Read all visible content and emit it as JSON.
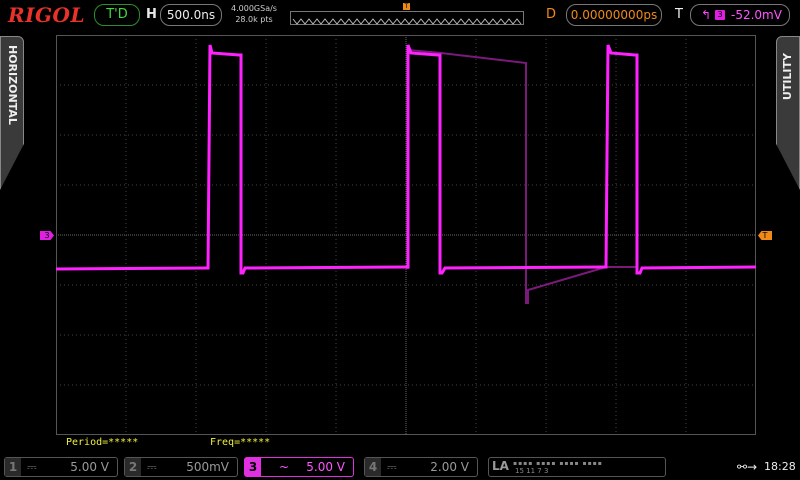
{
  "header": {
    "brand": "RIGOL",
    "run_status": "T'D",
    "horizontal_label": "H",
    "timebase": "500.0ns",
    "sample_rate": "4.000GSa/s",
    "memory_depth": "28.0k pts",
    "trigger_position_marker": "T",
    "delay_label": "D",
    "delay_value": "0.00000000ps",
    "trigger_label": "T",
    "trigger_edge_icon": "rising-edge-icon",
    "trigger_source": "3",
    "trigger_level": "-52.0mV"
  },
  "side_tabs": {
    "left": "HORIZONTAL",
    "right": "UTILITY"
  },
  "markers": {
    "ch3_ground": "3",
    "trigger_level": "T"
  },
  "measurements": {
    "period": "Period=*****",
    "freq": "Freq=*****"
  },
  "channels": [
    {
      "num": "1",
      "coupling": "⎓",
      "scale": "5.00 V",
      "active": false
    },
    {
      "num": "2",
      "coupling": "⎓",
      "scale": "500mV",
      "active": false
    },
    {
      "num": "3",
      "coupling": "~",
      "scale": "5.00 V",
      "active": true
    },
    {
      "num": "4",
      "coupling": "⎓",
      "scale": "2.00 V",
      "active": false
    }
  ],
  "logic_analyzer": {
    "label": "LA",
    "dots": "▪▪▪▪ ▪▪▪▪ ▪▪▪▪ ▪▪▪▪",
    "numbers": "15        11        7        3"
  },
  "status": {
    "usb_icon": "usb-icon",
    "time": "18:28"
  },
  "colors": {
    "ch3": "#e020e0",
    "trigger": "#f08a17",
    "brand": "#e8322a",
    "run": "#42d642",
    "measure": "#f0f040"
  }
}
